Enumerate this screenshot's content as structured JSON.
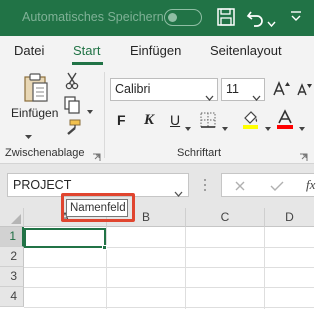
{
  "titlebar": {
    "autosave_label": "Automatisches Speichern",
    "autosave_state": "off",
    "icons": [
      "save-icon",
      "undo-icon",
      "undo-dropdown-icon",
      "customize-qat-icon"
    ]
  },
  "tabs": [
    {
      "label": "Datei",
      "active": false
    },
    {
      "label": "Start",
      "active": true
    },
    {
      "label": "Einfügen",
      "active": false
    },
    {
      "label": "Seitenlayout",
      "active": false
    }
  ],
  "ribbon": {
    "clipboard_group": {
      "label": "Zwischenablage",
      "paste_label": "Einfügen",
      "icons": [
        "paste-icon",
        "cut-icon",
        "copy-icon",
        "format-painter-icon"
      ]
    },
    "font_group": {
      "label": "Schriftart",
      "font_name": "Calibri",
      "font_size": "11",
      "bold": "F",
      "italic": "K",
      "underline": "U",
      "icons": [
        "increase-font-icon",
        "borders-icon",
        "fill-color-icon",
        "font-color-icon"
      ]
    }
  },
  "formula_bar": {
    "namebox_value": "PROJECT",
    "fx_label": "fx",
    "icons": [
      "cancel-icon",
      "enter-icon"
    ]
  },
  "tooltip": {
    "text": "Namenfeld"
  },
  "grid": {
    "columns": [
      "A",
      "B",
      "C",
      "D"
    ],
    "rows": [
      "1",
      "2",
      "3",
      "4"
    ],
    "active_cell": "A1"
  },
  "colors": {
    "excel_green": "#217346",
    "highlight_red": "#e0452f",
    "fill_yellow": "#ffff00",
    "font_red": "#ff0000"
  }
}
